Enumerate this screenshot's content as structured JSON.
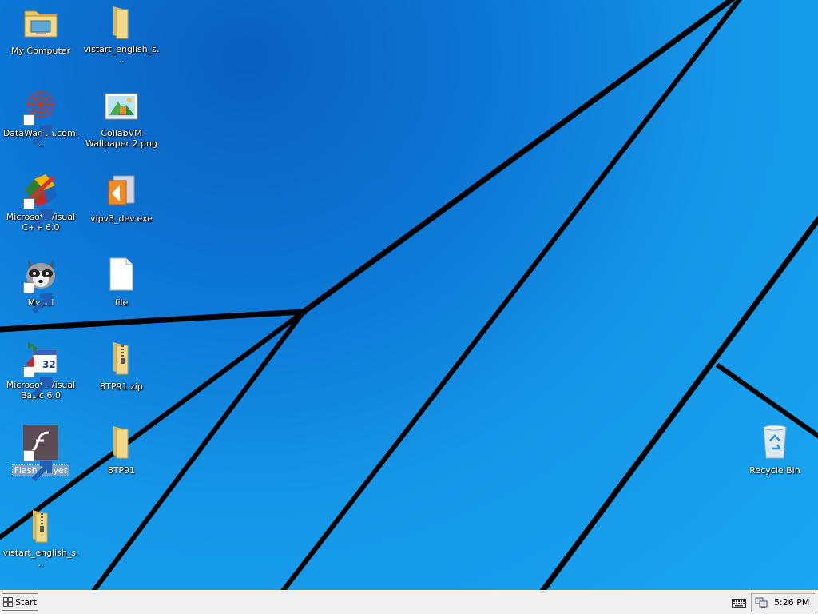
{
  "desktop": {
    "icons": [
      {
        "label": "My Computer",
        "icon": "my-computer-icon"
      },
      {
        "label": "vistart_english_s...",
        "icon": "folder-icon"
      },
      {
        "label": "DataWagon.com...",
        "icon": "datawagon-icon"
      },
      {
        "label": "CollabVM Wallpaper 2.png",
        "icon": "image-file-icon"
      },
      {
        "label": "Microsoft Visual C++ 6.0",
        "icon": "visual-cpp-icon"
      },
      {
        "label": "vipv3_dev.exe",
        "icon": "installer-icon"
      },
      {
        "label": "Mypal",
        "icon": "mypal-raccoon-icon"
      },
      {
        "label": "file",
        "icon": "blank-file-icon"
      },
      {
        "label": "Microsoft Visual Basic 6.0",
        "icon": "visual-basic-icon"
      },
      {
        "label": "8TP91.zip",
        "icon": "zip-folder-icon"
      },
      {
        "label": "Flash Player",
        "icon": "flash-player-icon"
      },
      {
        "label": "8TP91",
        "icon": "folder-icon"
      },
      {
        "label": "vistart_english_s...",
        "icon": "zip-folder-icon"
      },
      {
        "label": "Recycle Bin",
        "icon": "recycle-bin-icon"
      }
    ]
  },
  "taskbar": {
    "start_label": "Start",
    "clock": "5:26 PM"
  },
  "colors": {
    "desktop_blue": "#1597e8",
    "taskbar_bg": "#f0f0f0"
  }
}
